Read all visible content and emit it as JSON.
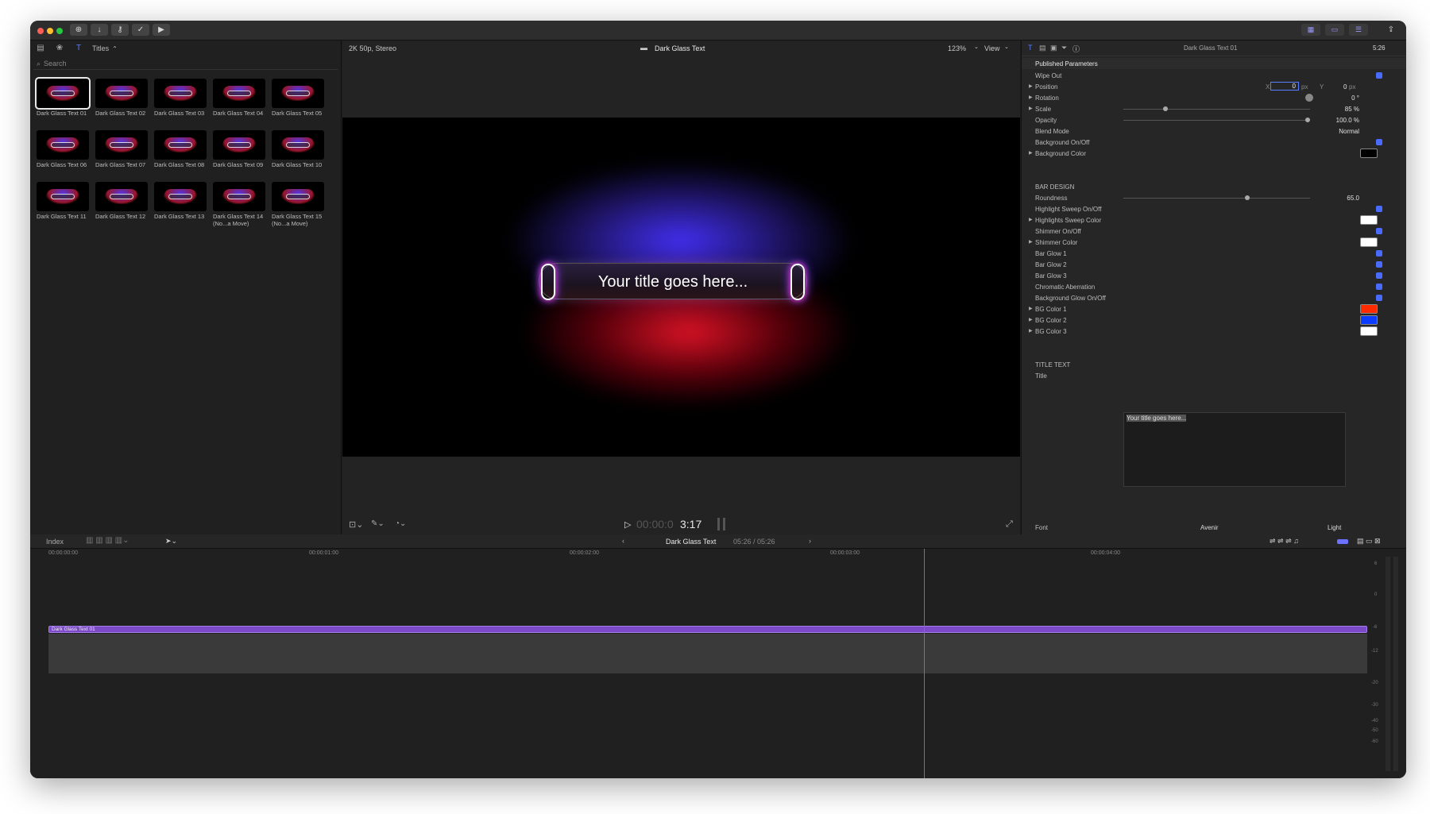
{
  "toolbar": {
    "right_buttons": [
      "grid",
      "list",
      "adjust"
    ]
  },
  "browser": {
    "category": "Titles",
    "search_placeholder": "Search",
    "items": [
      "Dark Glass Text 01",
      "Dark Glass Text 02",
      "Dark Glass Text 03",
      "Dark Glass Text 04",
      "Dark Glass Text 05",
      "Dark Glass Text 06",
      "Dark Glass Text 07",
      "Dark Glass Text 08",
      "Dark Glass Text 09",
      "Dark Glass Text 10",
      "Dark Glass Text 11",
      "Dark Glass Text 12",
      "Dark Glass Text 13",
      "Dark Glass Text 14 (No...a Move)",
      "Dark Glass Text 15 (No...a Move)"
    ]
  },
  "viewer": {
    "format": "2K 50p, Stereo",
    "clip_name": "Dark Glass Text",
    "zoom": "123%",
    "view_label": "View",
    "title_text": "Your title goes here...",
    "timecode_dim": "00:00:0",
    "timecode": "3:17"
  },
  "inspector": {
    "clip_title": "Dark Glass Text 01",
    "duration": "5:26",
    "section_published": "Published Parameters",
    "rows": {
      "wipe_out": "Wipe Out",
      "position": "Position",
      "pos_x_label": "X",
      "pos_x": "0",
      "pos_unit": "px",
      "pos_y_label": "Y",
      "pos_y": "0",
      "rotation": "Rotation",
      "rotation_val": "0 °",
      "scale": "Scale",
      "scale_val": "85 %",
      "opacity": "Opacity",
      "opacity_val": "100.0 %",
      "blend_mode": "Blend Mode",
      "blend_val": "Normal",
      "bg_onoff": "Background On/Off",
      "bg_color": "Background Color",
      "bar_design": "BAR DESIGN",
      "roundness": "Roundness",
      "roundness_val": "65.0",
      "hl_sweep": "Highlight Sweep On/Off",
      "hl_sweep_color": "Highlights Sweep Color",
      "shimmer": "Shimmer On/Off",
      "shimmer_color": "Shimmer Color",
      "bar_glow1": "Bar Glow 1",
      "bar_glow2": "Bar Glow 2",
      "bar_glow3": "Bar Glow 3",
      "chromatic": "Chromatic Aberration",
      "bg_glow": "Background Glow On/Off",
      "bg_color1": "BG Color 1",
      "bg_color2": "BG Color 2",
      "bg_color3": "BG Color 3",
      "title_text_section": "TITLE TEXT",
      "title_label": "Title",
      "title_value": "Your title goes here...",
      "font_label": "Font",
      "font_val": "Avenir",
      "weight_val": "Light"
    },
    "colors": {
      "bg_color": "#000000",
      "hl_sweep": "#ffffff",
      "shimmer": "#ffffff",
      "bg1": "#ff2a00",
      "bg2": "#0a3bff",
      "bg3": "#ffffff"
    }
  },
  "timeline": {
    "index_label": "Index",
    "project_name": "Dark Glass Text",
    "duration": "05:26 / 05:26",
    "ruler": [
      "00:00:00:00",
      "00:00:01:00",
      "00:00:02:00",
      "00:00:03:00",
      "00:00:04:00"
    ],
    "clip_label": "Dark Glass Text 01",
    "meter_marks": [
      "6",
      "0",
      "-6",
      "-12",
      "-20",
      "-30",
      "-40",
      "-50",
      "-60"
    ]
  }
}
